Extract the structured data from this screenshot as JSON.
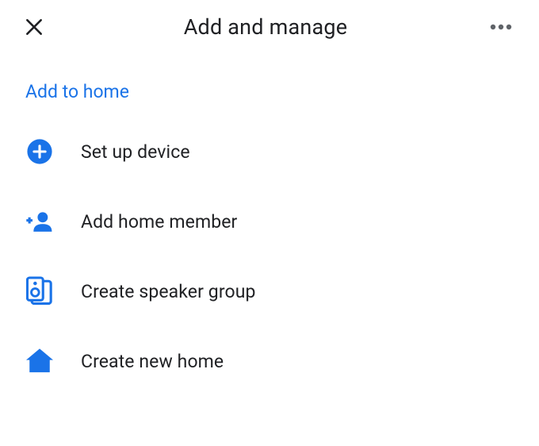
{
  "header": {
    "title": "Add and manage"
  },
  "section": {
    "title": "Add to home"
  },
  "colors": {
    "accent": "#1a73e8",
    "icon": "#1a73e8",
    "text": "#202124"
  },
  "items": [
    {
      "icon": "plus-circle-icon",
      "label": "Set up device"
    },
    {
      "icon": "add-person-icon",
      "label": "Add home member"
    },
    {
      "icon": "speaker-group-icon",
      "label": "Create speaker group"
    },
    {
      "icon": "home-icon",
      "label": "Create new home"
    }
  ]
}
